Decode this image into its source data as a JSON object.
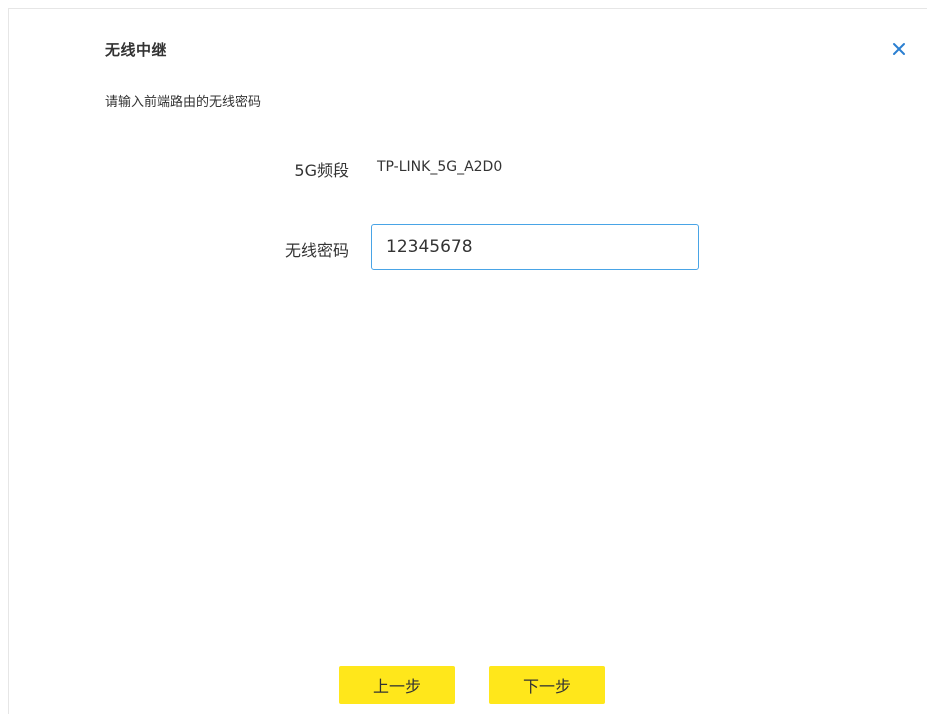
{
  "dialog": {
    "title": "无线中继",
    "subtitle": "请输入前端路由的无线密码",
    "close_icon": "close-icon",
    "accent_color": "#49a4e6"
  },
  "form": {
    "band": {
      "label": "5G频段",
      "value": "TP-LINK_5G_A2D0"
    },
    "password": {
      "label": "无线密码",
      "value": "12345678"
    }
  },
  "footer": {
    "prev_label": "上一步",
    "next_label": "下一步",
    "button_color": "#ffe71b"
  }
}
